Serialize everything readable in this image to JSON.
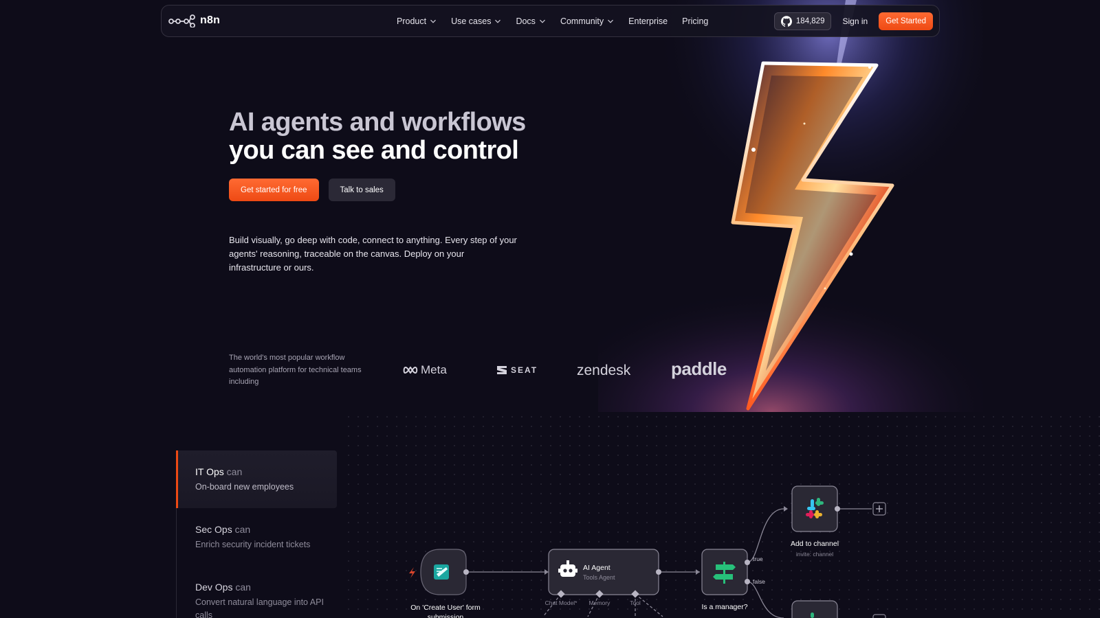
{
  "brand": {
    "name": "n8n",
    "accent": "#ee4a14"
  },
  "nav": {
    "links": [
      {
        "label": "Product",
        "dropdown": true
      },
      {
        "label": "Use cases",
        "dropdown": true
      },
      {
        "label": "Docs",
        "dropdown": true
      },
      {
        "label": "Community",
        "dropdown": true
      },
      {
        "label": "Enterprise",
        "dropdown": false
      },
      {
        "label": "Pricing",
        "dropdown": false
      }
    ],
    "github_stars": "184,829",
    "sign_in": "Sign in",
    "cta": "Get Started"
  },
  "hero": {
    "title_line1": "AI agents and workflows",
    "title_line2": "you can see and control",
    "primary_button": "Get started for free",
    "secondary_button": "Talk to sales",
    "description": "Build visually, go deep with code, connect to anything. Every step of your agents' reasoning, traceable on the canvas. Deploy on your infrastructure or ours."
  },
  "trust": {
    "text": "The world's most popular workflow automation platform for technical teams including",
    "logos": [
      "Meta",
      "SEAT",
      "zendesk",
      "paddle"
    ]
  },
  "tabs": [
    {
      "role": "IT Ops",
      "can": "can",
      "desc": "On-board new employees",
      "active": true
    },
    {
      "role": "Sec Ops",
      "can": "can",
      "desc": "Enrich security incident tickets",
      "active": false
    },
    {
      "role": "Dev Ops",
      "can": "can",
      "desc": "Convert natural language into API calls",
      "active": false
    }
  ],
  "workflow": {
    "trigger": {
      "label": "On 'Create User' form submission"
    },
    "agent": {
      "title": "AI Agent",
      "subtitle": "Tools Agent",
      "ports": [
        "Chat Model*",
        "Memory",
        "Tool"
      ]
    },
    "condition": {
      "label": "Is a manager?",
      "true_label": "true",
      "false_label": "false"
    },
    "slack_node": {
      "label": "Add to channel",
      "sub": "invite: channel"
    }
  }
}
